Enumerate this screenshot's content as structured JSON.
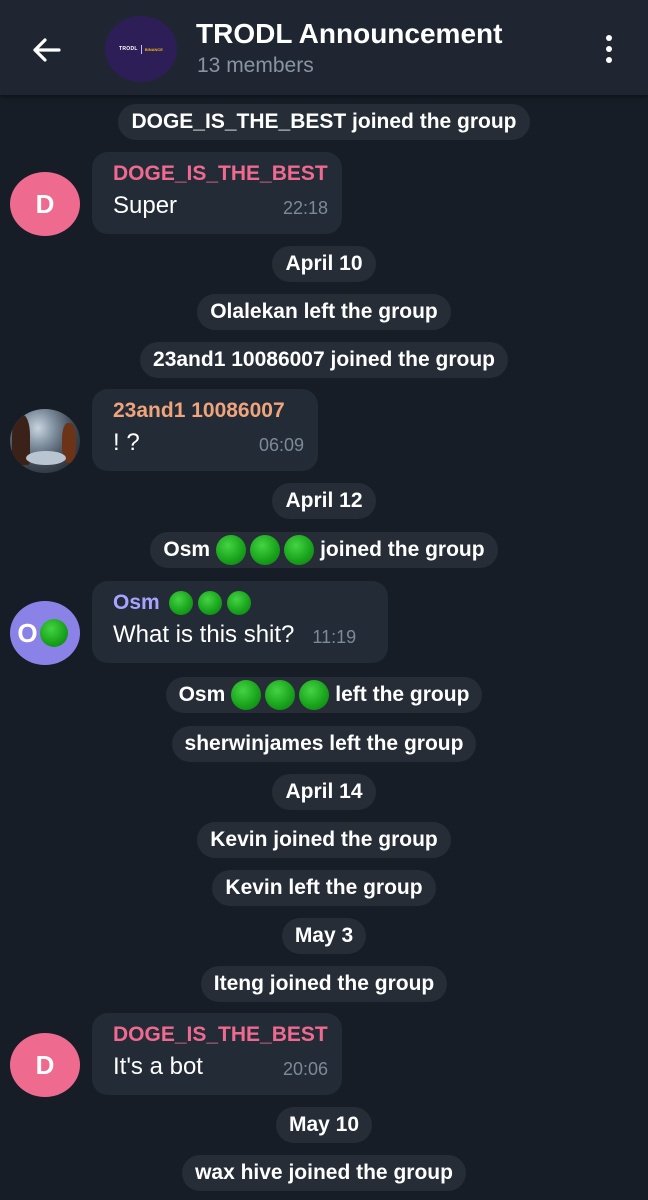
{
  "header": {
    "title": "TRODL Announcement",
    "subtitle": "13 members",
    "back_icon": "arrow-left-icon",
    "menu_icon": "more-vertical-icon",
    "avatar_logo_left": "TRODL",
    "avatar_logo_right": "BINANCE"
  },
  "colors": {
    "background": "#161d26",
    "header": "#1f2631",
    "bubble": "#232b37",
    "service_pill": "#262d37",
    "name_pink": "#f06a8f",
    "name_orange": "#f0a47c",
    "name_purple": "#a6a4ff",
    "green_circle": "#1aa51d"
  },
  "messages": [
    {
      "type": "service",
      "text": "DOGE_IS_THE_BEST joined the group"
    },
    {
      "type": "message",
      "sender": "DOGE_IS_THE_BEST",
      "avatar_letter": "D",
      "text": "Super",
      "time": "22:18"
    },
    {
      "type": "date",
      "text": "April 10"
    },
    {
      "type": "service",
      "text": "Olalekan left the group"
    },
    {
      "type": "service",
      "text": "23and1 10086007 joined the group"
    },
    {
      "type": "message",
      "sender": "23and1 10086007",
      "avatar": "photo",
      "text": "! ?",
      "time": "06:09"
    },
    {
      "type": "date",
      "text": "April 12"
    },
    {
      "type": "service",
      "name": "Osm",
      "text": "joined the group"
    },
    {
      "type": "message",
      "sender": "Osm",
      "avatar_letter": "O",
      "text": "What is this shit?",
      "time": "11:19"
    },
    {
      "type": "service",
      "name": "Osm",
      "text": "left the group"
    },
    {
      "type": "service",
      "text": "sherwinjames left the group"
    },
    {
      "type": "date",
      "text": "April 14"
    },
    {
      "type": "service",
      "text": "Kevin joined the group"
    },
    {
      "type": "service",
      "text": "Kevin left the group"
    },
    {
      "type": "date",
      "text": "May 3"
    },
    {
      "type": "service",
      "text": "Iteng joined the group"
    },
    {
      "type": "message",
      "sender": "DOGE_IS_THE_BEST",
      "avatar_letter": "D",
      "text": "It's a bot",
      "time": "20:06"
    },
    {
      "type": "date",
      "text": "May 10"
    },
    {
      "type": "service",
      "text": "wax hive joined the group"
    }
  ]
}
